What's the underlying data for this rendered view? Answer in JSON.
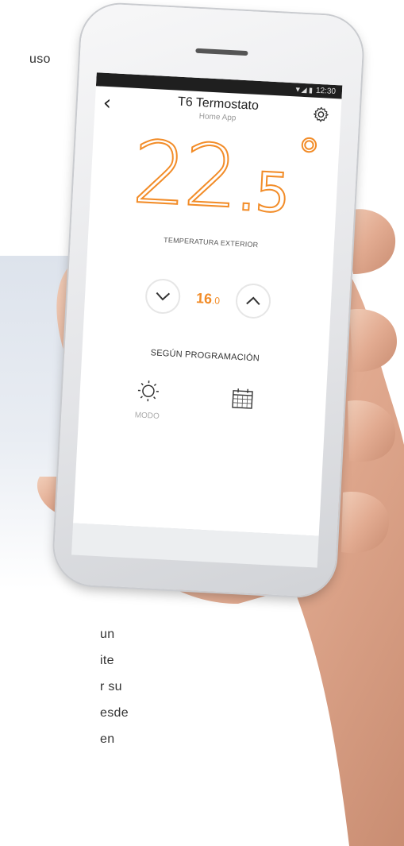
{
  "side_text": {
    "top": "uso",
    "lines": [
      "un",
      "ite",
      "r su",
      "esde",
      "en"
    ]
  },
  "status_bar": {
    "time": "12:30",
    "icons": "▼◢ ▮"
  },
  "app": {
    "title": "T6 Termostato",
    "subtitle": "Home App",
    "back_icon": "‹",
    "temperature": {
      "integer": "22",
      "decimal": ".5",
      "degree": "°"
    },
    "outside_label": "TEMPERATURA EXTERIOR",
    "setpoint": {
      "value": "16",
      "unit": ".0"
    },
    "program_label": "SEGÚN PROGRAMACIÓN",
    "mode_label": "MODO"
  },
  "colors": {
    "accent": "#f28c28",
    "status_bar": "#1f1f1f"
  }
}
